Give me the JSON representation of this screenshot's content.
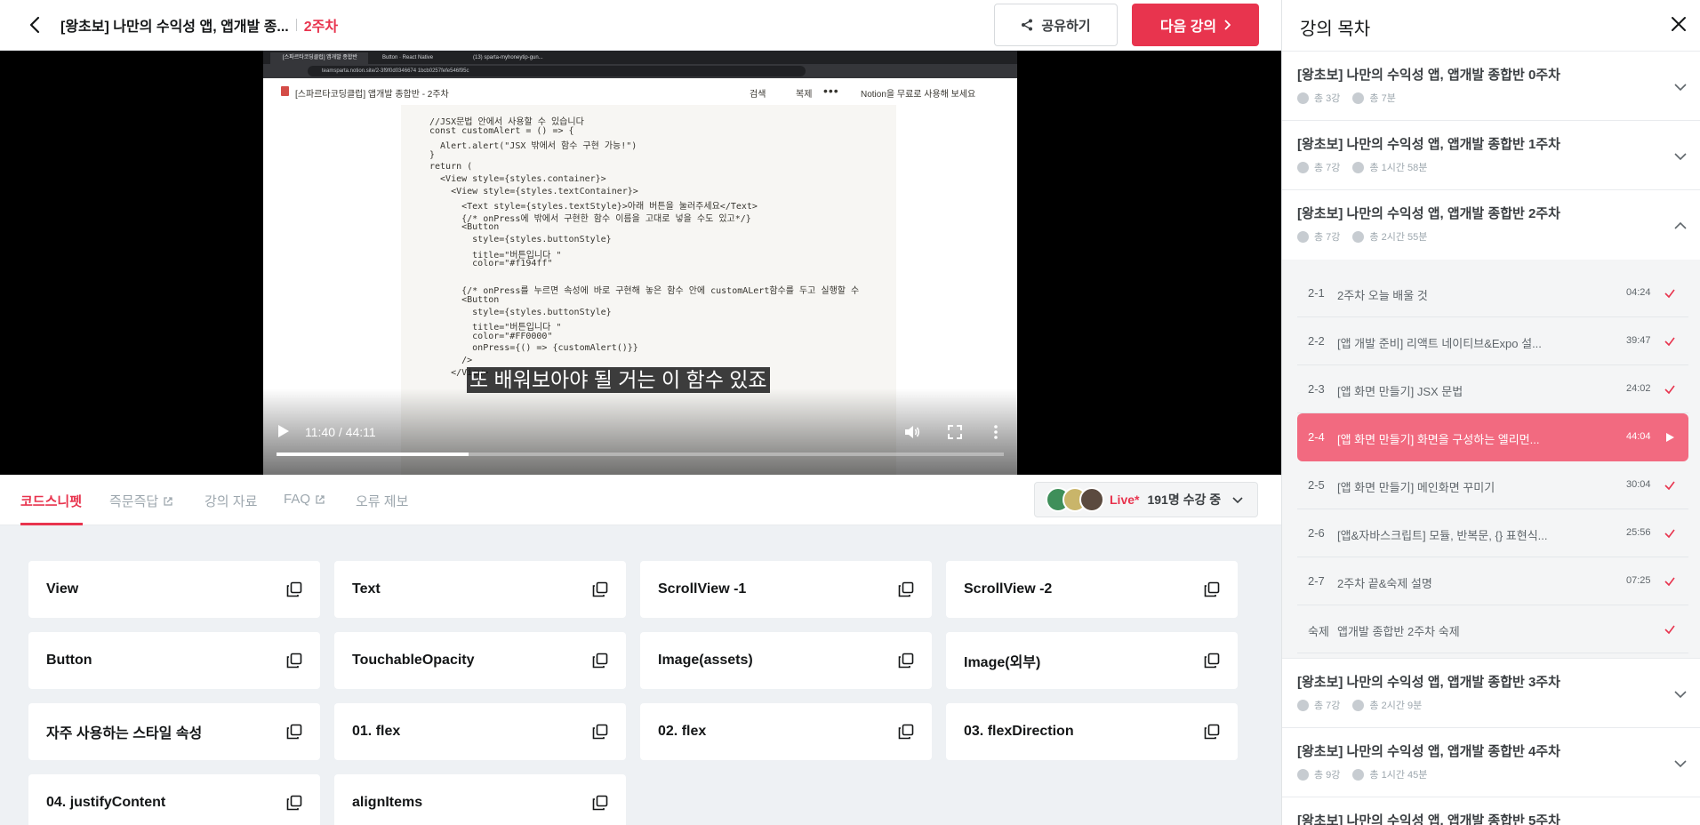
{
  "header": {
    "course_title": "[왕초보] 나만의 수익성 앱, 앱개발 종...",
    "week_badge": "2주차",
    "share_label": "공유하기",
    "next_label": "다음 강의"
  },
  "video": {
    "browser_tabs": [
      "[스파르타코딩클럽] 앱개발 종합반",
      "Button · React Native",
      "(13) sparta-myhoneytip-gun..."
    ],
    "address": "teamsparta.notion.site/2-3f9f0d0346674 1bcb0257fefe546f95c",
    "notion_page_title": "[스파르타코딩클럽] 앱개발 종합반 - 2주차",
    "notion_search": "검색",
    "notion_duplicate": "복제",
    "notion_cta": "Notion을 무료로 사용해 보세요",
    "code_lines": [
      "//JSX문법 안에서 사용할 수 있습니다",
      "const customAlert = () => {",
      "  Alert.alert(\"JSX 밖에서 함수 구현 가능!\")",
      "}",
      "return (",
      "  <View style={styles.container}>",
      "    <View style={styles.textContainer}>",
      "      <Text style={styles.textStyle}>아래 버튼을 눌러주세요</Text>",
      "      {/* onPress에 밖에서 구현한 함수 이름을 고대로 넣을 수도 있고*/}",
      "      <Button",
      "        style={styles.buttonStyle}",
      "        title=\"버튼입니다 \"",
      "        color=\"#f194ff\"",
      "",
      "      {/* onPress를 누르면 속성에 바로 구현해 놓은 함수 안에 customALert함수를 두고 실행할 수",
      "      <Button",
      "        style={styles.buttonStyle}",
      "        title=\"버튼입니다 \"",
      "        color=\"#FF0000\"",
      "        onPress={() => {customAlert()}}",
      "      />",
      "    </View>"
    ],
    "subtitle": "또 배워보아야 될 거는 이 함수 있죠",
    "time_display": "11:40 / 44:11",
    "progress_fraction": 0.264
  },
  "tabs": [
    {
      "label": "코드스니펫",
      "external": false,
      "active": true
    },
    {
      "label": "즉문즉답",
      "external": true,
      "active": false
    },
    {
      "label": "강의 자료",
      "external": false,
      "active": false
    },
    {
      "label": "FAQ",
      "external": true,
      "active": false
    },
    {
      "label": "오류 제보",
      "external": false,
      "active": false
    }
  ],
  "live": {
    "label": "Live*",
    "count_text": "191명 수강 중"
  },
  "snippets": [
    "View",
    "Text",
    "ScrollView -1",
    "ScrollView -2",
    "Button",
    "TouchableOpacity",
    "Image(assets)",
    "Image(외부)",
    "자주 사용하는 스타일 속성",
    "01. flex",
    "02. flex",
    "03. flexDirection",
    "04. justifyContent",
    "alignItems"
  ],
  "sidebar": {
    "title": "강의 목차",
    "weeks": [
      {
        "title": "[왕초보] 나만의 수익성 앱, 앱개발 종합반 0주차",
        "lessons": "총 3강",
        "duration": "총 7분",
        "expanded": false
      },
      {
        "title": "[왕초보] 나만의 수익성 앱, 앱개발 종합반 1주차",
        "lessons": "총 7강",
        "duration": "총 1시간 58분",
        "expanded": false
      },
      {
        "title": "[왕초보] 나만의 수익성 앱, 앱개발 종합반 2주차",
        "lessons": "총 7강",
        "duration": "총 2시간 55분",
        "expanded": true
      },
      {
        "title": "[왕초보] 나만의 수익성 앱, 앱개발 종합반 3주차",
        "lessons": "총 7강",
        "duration": "총 2시간 9분",
        "expanded": false
      },
      {
        "title": "[왕초보] 나만의 수익성 앱, 앱개발 종합반 4주차",
        "lessons": "총 9강",
        "duration": "총 1시간 45분",
        "expanded": false
      },
      {
        "title": "[왕초보] 나만의 수익성 앱, 앱개발 종합반 5주차",
        "lessons": "",
        "duration": "",
        "expanded": false
      }
    ],
    "lessons": [
      {
        "num": "2-1",
        "title": "2주차 오늘 배울 것",
        "time": "04:24",
        "status": "done"
      },
      {
        "num": "2-2",
        "title": "[앱 개발 준비] 리액트 네이티브&Expo 설...",
        "time": "39:47",
        "status": "done"
      },
      {
        "num": "2-3",
        "title": "[앱 화면 만들기] JSX 문법",
        "time": "24:02",
        "status": "done"
      },
      {
        "num": "2-4",
        "title": "[앱 화면 만들기] 화면을 구성하는 엘리먼...",
        "time": "44:04",
        "status": "playing"
      },
      {
        "num": "2-5",
        "title": "[앱 화면 만들기] 메인화면 꾸미기",
        "time": "30:04",
        "status": "done"
      },
      {
        "num": "2-6",
        "title": "[앱&자바스크립트] 모듈, 반복문, {} 표현식...",
        "time": "25:56",
        "status": "done"
      },
      {
        "num": "2-7",
        "title": "2주차 끝&숙제 설명",
        "time": "07:25",
        "status": "done"
      },
      {
        "num": "숙제",
        "title": "앱개발 종합반 2주차 숙제",
        "time": "",
        "status": "done"
      }
    ]
  },
  "colors": {
    "accent": "#e8344e",
    "active_lesson": "#f26a80",
    "snippet_bg": "#eef1f4"
  }
}
